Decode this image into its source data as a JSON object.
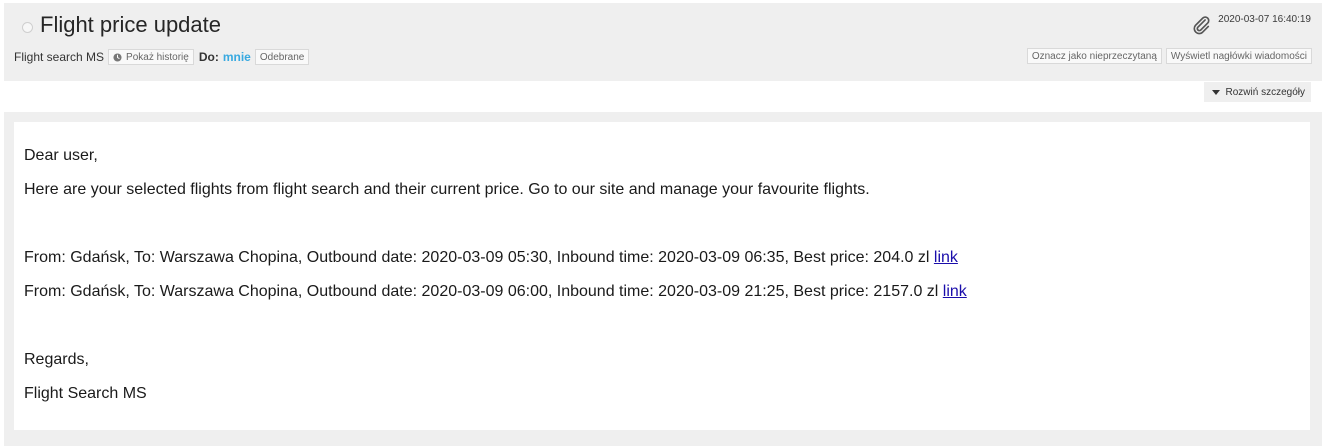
{
  "header": {
    "subject": "Flight price update",
    "date": "2020-03-07 16:40:19",
    "sender": "Flight search MS",
    "history_button": "Pokaż historię",
    "to_label": "Do:",
    "to_value": "mnie",
    "folder_badge": "Odebrane",
    "mark_unread_button": "Oznacz jako nieprzeczytaną",
    "show_headers_button": "Wyświetl nagłówki wiadomości",
    "expand_details_button": "Rozwiń szczegóły"
  },
  "message": {
    "greeting": "Dear user,",
    "intro": "Here are your selected flights from flight search and their current price. Go to our site and manage your favourite flights.",
    "flights": [
      {
        "text": "From: Gdańsk, To: Warszawa Chopina, Outbound date: 2020-03-09 05:30, Inbound time: 2020-03-09 06:35, Best price: 204.0 zl ",
        "link": "link"
      },
      {
        "text": "From: Gdańsk, To: Warszawa Chopina, Outbound date: 2020-03-09 06:00, Inbound time: 2020-03-09 21:25, Best price: 2157.0 zl ",
        "link": "link"
      }
    ],
    "regards": "Regards,",
    "signature": "Flight Search MS"
  },
  "icons": {
    "status": "status-circle-icon",
    "attachment": "paperclip-icon",
    "history": "clock-icon",
    "expand": "triangle-down-icon"
  },
  "colors": {
    "header_bg": "#efefef",
    "recipient": "#38a9e0",
    "link": "#1a0dab"
  }
}
